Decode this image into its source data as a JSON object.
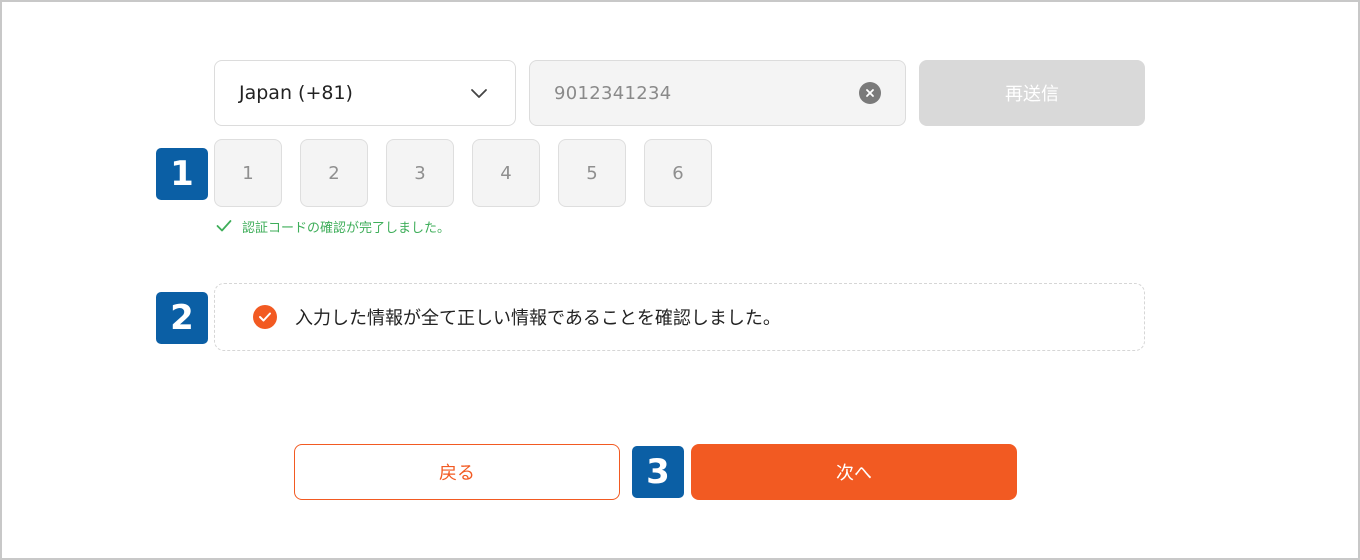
{
  "phone": {
    "country_label": "Japan (+81)",
    "number_value": "9012341234",
    "resend_label": "再送信"
  },
  "verification": {
    "code_digits": [
      "1",
      "2",
      "3",
      "4",
      "5",
      "6"
    ],
    "success_message": "認証コードの確認が完了しました。"
  },
  "confirmation": {
    "checked": true,
    "text": "入力した情報が全て正しい情報であることを確認しました。"
  },
  "actions": {
    "back_label": "戻る",
    "next_label": "次へ"
  },
  "step_badges": [
    "1",
    "2",
    "3"
  ],
  "icons": {
    "country_dropdown": "chevron-down-icon",
    "clear_input": "close-circle-icon",
    "success": "checkmark-icon",
    "confirm": "check-circle-icon"
  },
  "colors": {
    "accent": "#f25a22",
    "badge": "#0b5fa5",
    "success": "#3fae5a",
    "disabled": "#d9d9d9"
  }
}
